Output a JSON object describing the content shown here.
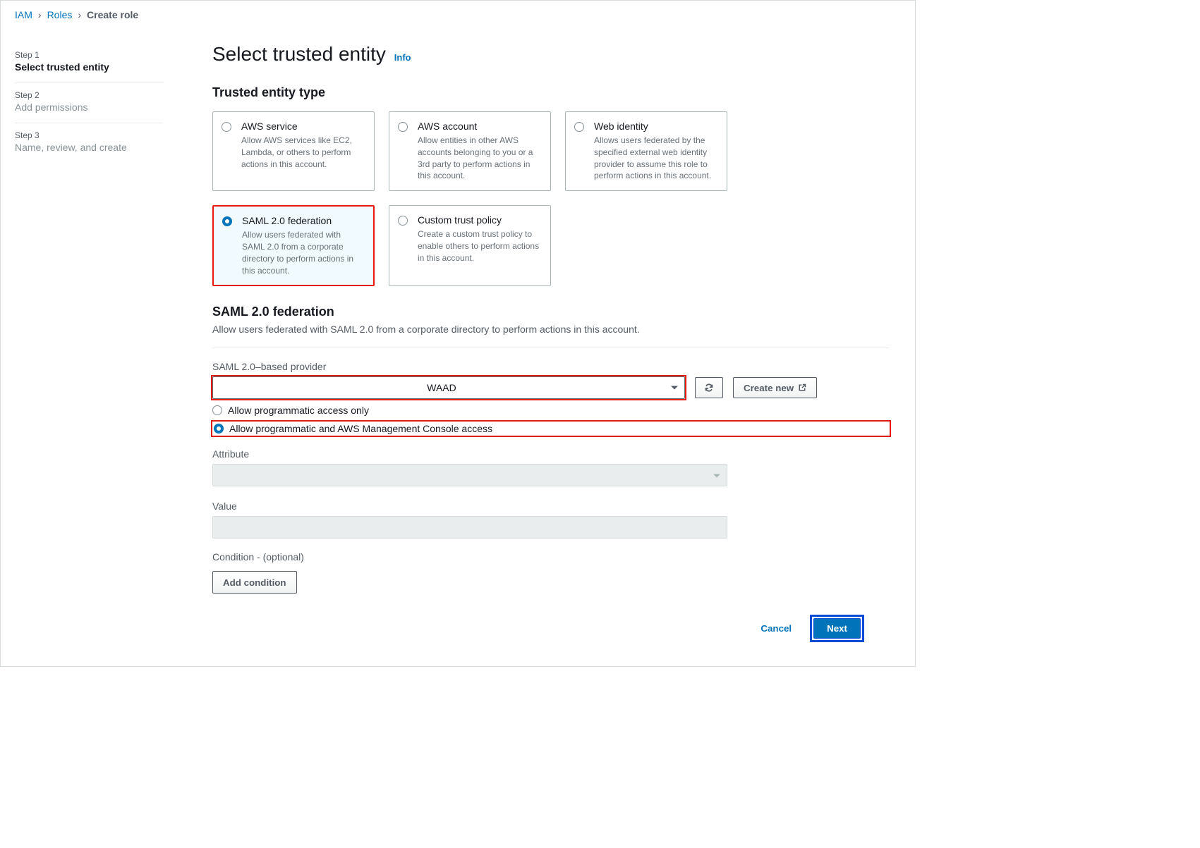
{
  "breadcrumb": {
    "iam": "IAM",
    "roles": "Roles",
    "current": "Create role"
  },
  "sidebar": {
    "steps": [
      {
        "label": "Step 1",
        "title": "Select trusted entity"
      },
      {
        "label": "Step 2",
        "title": "Add permissions"
      },
      {
        "label": "Step 3",
        "title": "Name, review, and create"
      }
    ]
  },
  "page": {
    "heading": "Select trusted entity",
    "info": "Info",
    "entity_type_heading": "Trusted entity type"
  },
  "entities": [
    {
      "title": "AWS service",
      "desc": "Allow AWS services like EC2, Lambda, or others to perform actions in this account."
    },
    {
      "title": "AWS account",
      "desc": "Allow entities in other AWS accounts belonging to you or a 3rd party to perform actions in this account."
    },
    {
      "title": "Web identity",
      "desc": "Allows users federated by the specified external web identity provider to assume this role to perform actions in this account."
    },
    {
      "title": "SAML 2.0 federation",
      "desc": "Allow users federated with SAML 2.0 from a corporate directory to perform actions in this account."
    },
    {
      "title": "Custom trust policy",
      "desc": "Create a custom trust policy to enable others to perform actions in this account."
    }
  ],
  "saml": {
    "heading": "SAML 2.0 federation",
    "desc": "Allow users federated with SAML 2.0 from a corporate directory to perform actions in this account.",
    "provider_label": "SAML 2.0–based provider",
    "provider_value": "WAAD",
    "create_new": "Create new",
    "access_options": [
      "Allow programmatic access only",
      "Allow programmatic and AWS Management Console access"
    ],
    "attribute_label": "Attribute",
    "attribute_value": "",
    "value_label": "Value",
    "value_value": "",
    "condition_label": "Condition - (optional)",
    "add_condition": "Add condition"
  },
  "footer": {
    "cancel": "Cancel",
    "next": "Next"
  }
}
